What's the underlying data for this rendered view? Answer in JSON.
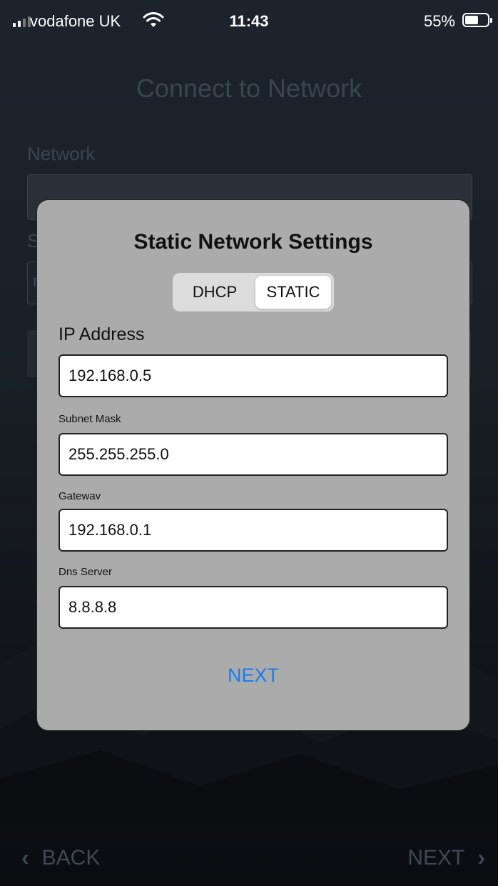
{
  "status_bar": {
    "carrier": "vodafone UK",
    "time": "11:43",
    "battery_pct": "55%"
  },
  "background": {
    "title": "Connect to Network",
    "network_label": "Network",
    "second_label_partial": "S",
    "second_field_partial": "r",
    "back_label": "BACK",
    "next_label": "NEXT"
  },
  "modal": {
    "title": "Static Network Settings",
    "segment": {
      "options": [
        "DHCP",
        "STATIC"
      ],
      "selected": "STATIC"
    },
    "ip": {
      "label": "IP Address",
      "value": "192.168.0.5"
    },
    "subnet": {
      "label": "Subnet Mask",
      "value": "255.255.255.0"
    },
    "gateway": {
      "label": "Gatewav",
      "value": "192.168.0.1"
    },
    "dns": {
      "label": "Dns Server",
      "value": "8.8.8.8"
    },
    "next_label": "NEXT"
  },
  "colors": {
    "accent": "#1a7cf2",
    "modal_bg": "#ababab"
  }
}
